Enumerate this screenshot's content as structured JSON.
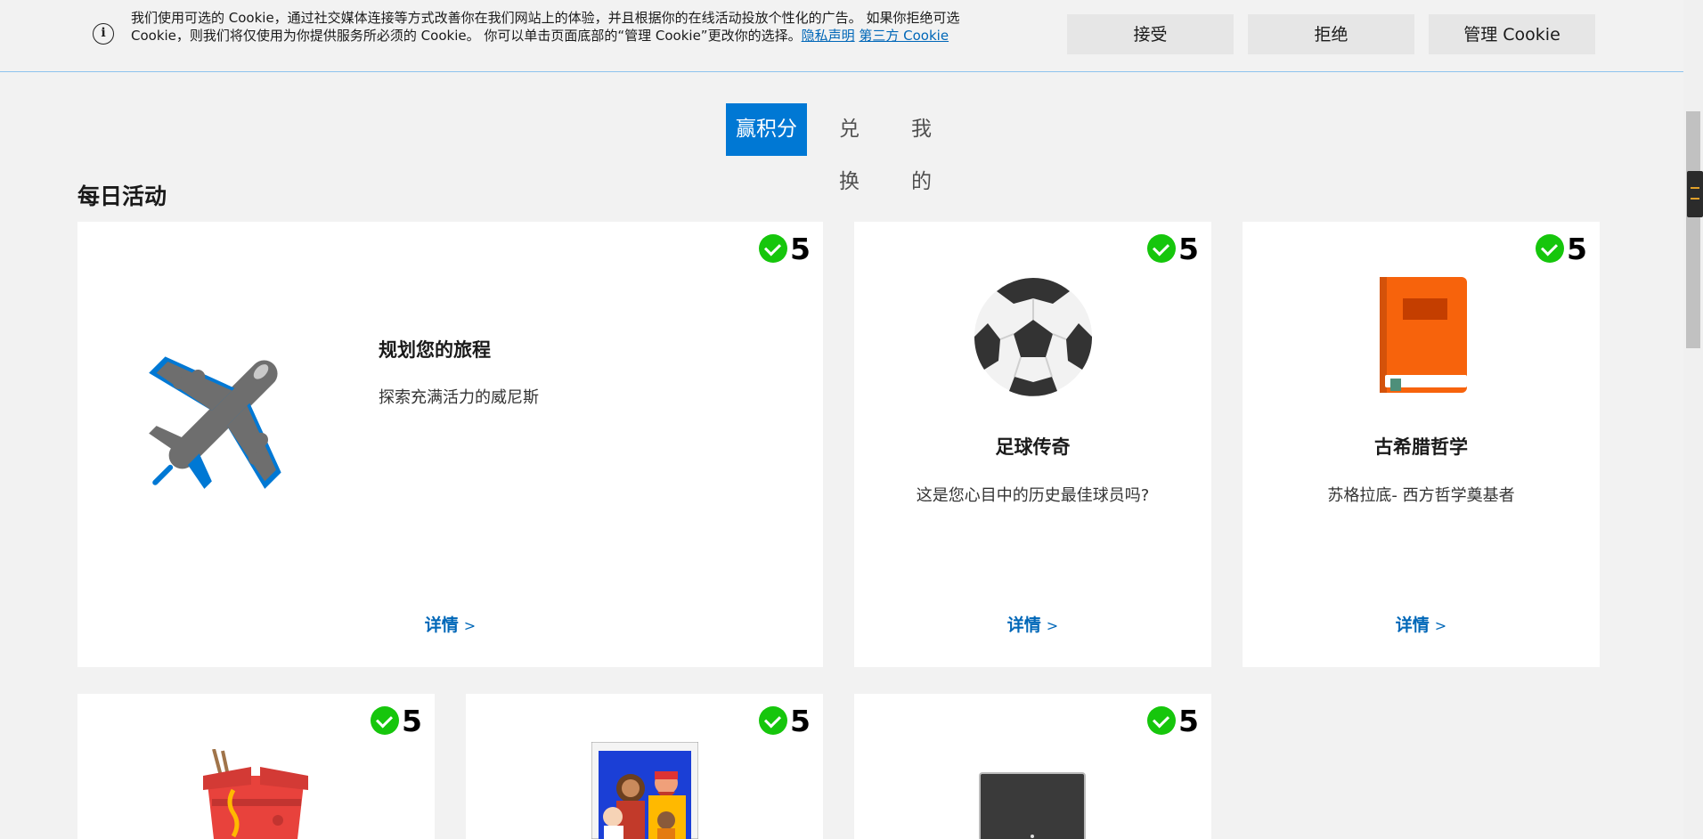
{
  "cookie": {
    "message": "我们使用可选的 Cookie，通过社交媒体连接等方式改善你在我们网站上的体验，并且根据你的在线活动投放个性化的广告。 如果你拒绝可选 Cookie，则我们将仅使用为你提供服务所必须的 Cookie。 你可以单击页面底部的“管理 Cookie”更改你的选择。",
    "privacy_link": "隐私声明",
    "third_party_link": "第三方 Cookie",
    "accept_label": "接受",
    "reject_label": "拒绝",
    "manage_label": "管理 Cookie"
  },
  "tabs": [
    {
      "label": "赢积分",
      "active": true
    },
    {
      "label": "兑换",
      "active": false
    },
    {
      "label": "我的",
      "active": false
    }
  ],
  "section_title": "每日活动",
  "cards": [
    {
      "points": "5",
      "title": "规划您的旅程",
      "desc": "探索充满活力的威尼斯",
      "more": "详情",
      "chevron": ">",
      "icon": "airplane-icon"
    },
    {
      "points": "5",
      "title": "足球传奇",
      "desc": "这是您心目中的历史最佳球员吗?",
      "more": "详情",
      "chevron": ">",
      "icon": "soccer-ball-icon"
    },
    {
      "points": "5",
      "title": "古希腊哲学",
      "desc": "苏格拉底- 西方哲学奠基者",
      "more": "详情",
      "chevron": ">",
      "icon": "book-icon"
    },
    {
      "points": "5",
      "icon": "takeout-box-icon"
    },
    {
      "points": "5",
      "icon": "family-photo-icon"
    },
    {
      "points": "5",
      "icon": "tablet-icon"
    }
  ],
  "colors": {
    "accent": "#0078d4",
    "link": "#0067b8",
    "check": "#16c60c"
  }
}
